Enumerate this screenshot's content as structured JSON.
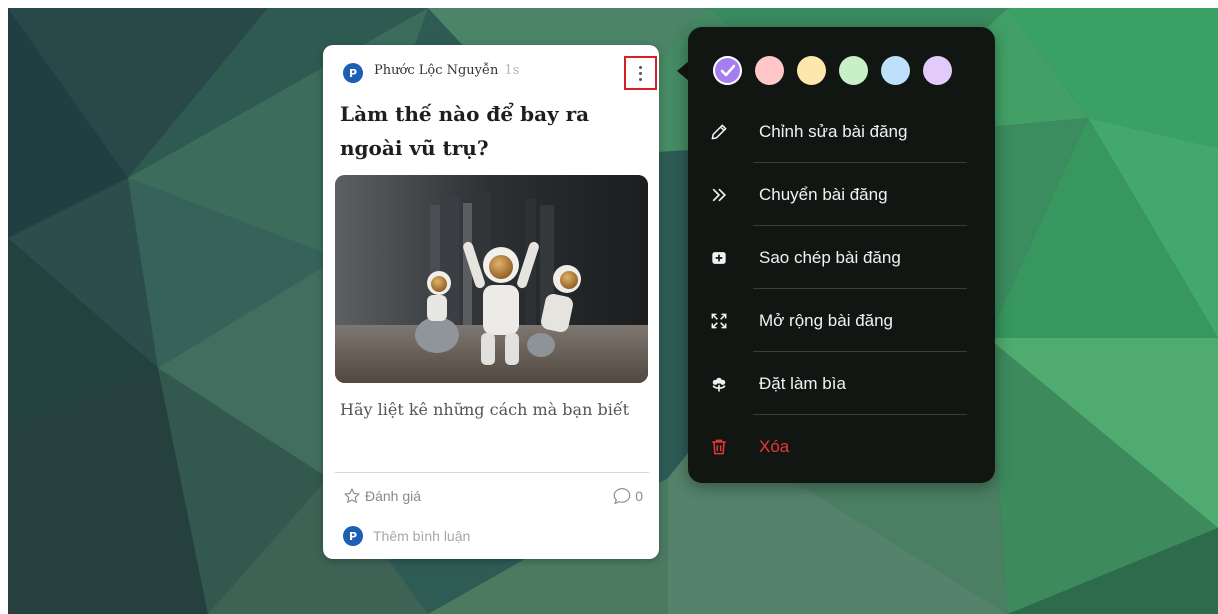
{
  "post": {
    "author_initial": "P",
    "author": "Phước Lộc Nguyễn",
    "time": "1s",
    "title": "Làm thế nào để bay ra ngoài vũ trụ?",
    "body": "Hãy liệt kê những cách mà bạn biết",
    "rate_label": "Đánh giá",
    "comment_count": "0",
    "add_comment": "Thêm bình luận",
    "commenter_initial": "P"
  },
  "menu": {
    "colors": [
      {
        "name": "purple",
        "hex": "#a57ef0",
        "selected": true
      },
      {
        "name": "pink",
        "hex": "#ffc7c7",
        "selected": false
      },
      {
        "name": "yellow",
        "hex": "#fde7ad",
        "selected": false
      },
      {
        "name": "green",
        "hex": "#c7f0c7",
        "selected": false
      },
      {
        "name": "blue",
        "hex": "#bfe0fb",
        "selected": false
      },
      {
        "name": "lavender",
        "hex": "#e2cbfa",
        "selected": false
      }
    ],
    "items": [
      {
        "icon": "pencil-icon",
        "label": "Chỉnh sửa bài đăng"
      },
      {
        "icon": "double-chevron-right-icon",
        "label": "Chuyển bài đăng"
      },
      {
        "icon": "duplicate-icon",
        "label": "Sao chép bài đăng"
      },
      {
        "icon": "expand-icon",
        "label": "Mở rộng bài đăng"
      },
      {
        "icon": "flower-icon",
        "label": "Đặt làm bìa"
      },
      {
        "icon": "trash-icon",
        "label": "Xóa"
      }
    ]
  },
  "colors": {
    "accent_highlight": "#d42026",
    "delete_red": "#e53935",
    "menu_bg": "#121613",
    "avatar_blue": "#1d5fb5"
  }
}
